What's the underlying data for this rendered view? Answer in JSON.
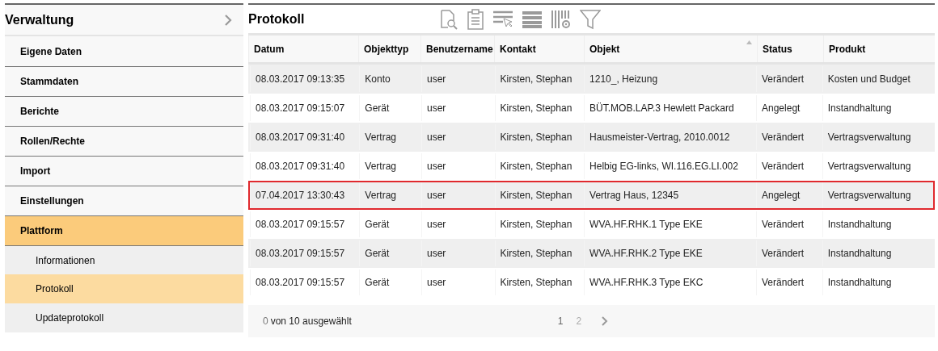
{
  "sidebar": {
    "title": "Verwaltung",
    "items": [
      {
        "label": "Eigene Daten",
        "selected": false
      },
      {
        "label": "Stammdaten",
        "selected": false
      },
      {
        "label": "Berichte",
        "selected": false
      },
      {
        "label": "Rollen/Rechte",
        "selected": false
      },
      {
        "label": "Import",
        "selected": false
      },
      {
        "label": "Einstellungen",
        "selected": false
      },
      {
        "label": "Plattform",
        "selected": true,
        "children": [
          {
            "label": "Informationen",
            "selected": false
          },
          {
            "label": "Protokoll",
            "selected": true
          },
          {
            "label": "Updateprotokoll",
            "selected": false
          }
        ]
      }
    ]
  },
  "main": {
    "title": "Protokoll",
    "table": {
      "columns": [
        {
          "label": "Datum",
          "sorted": false
        },
        {
          "label": "Objekttyp",
          "sorted": false
        },
        {
          "label": "Benutzername",
          "sorted": false
        },
        {
          "label": "Kontakt",
          "sorted": false
        },
        {
          "label": "Objekt",
          "sorted": true
        },
        {
          "label": "Status",
          "sorted": false
        },
        {
          "label": "Produkt",
          "sorted": false
        }
      ],
      "rows": [
        {
          "highlighted": false,
          "cells": [
            "08.03.2017 09:13:35",
            "Konto",
            "user",
            "Kirsten, Stephan",
            "1210_, Heizung",
            "Verändert",
            "Kosten und Budget"
          ]
        },
        {
          "highlighted": false,
          "cells": [
            "08.03.2017 09:15:07",
            "Gerät",
            "user",
            "Kirsten, Stephan",
            "BÜT.MOB.LAP.3 Hewlett Packard",
            "Angelegt",
            "Instandhaltung"
          ]
        },
        {
          "highlighted": false,
          "cells": [
            "08.03.2017 09:31:40",
            "Vertrag",
            "user",
            "Kirsten, Stephan",
            "Hausmeister-Vertrag, 2010.0012",
            "Verändert",
            "Vertragsverwaltung"
          ]
        },
        {
          "highlighted": false,
          "cells": [
            "08.03.2017 09:31:40",
            "Vertrag",
            "user",
            "Kirsten, Stephan",
            "Helbig EG-links, WI.116.EG.LI.002",
            "Verändert",
            "Vertragsverwaltung"
          ]
        },
        {
          "highlighted": true,
          "cells": [
            "07.04.2017 13:30:43",
            "Vertrag",
            "user",
            "Kirsten, Stephan",
            "Vertrag Haus, 12345",
            "Angelegt",
            "Vertragsverwaltung"
          ]
        },
        {
          "highlighted": false,
          "cells": [
            "08.03.2017 09:15:57",
            "Gerät",
            "user",
            "Kirsten, Stephan",
            "WVA.HF.RHK.1 Type EKE",
            "Verändert",
            "Instandhaltung"
          ]
        },
        {
          "highlighted": false,
          "cells": [
            "08.03.2017 09:15:57",
            "Gerät",
            "user",
            "Kirsten, Stephan",
            "WVA.HF.RHK.2 Type EKE",
            "Verändert",
            "Instandhaltung"
          ]
        },
        {
          "highlighted": false,
          "cells": [
            "08.03.2017 09:15:57",
            "Gerät",
            "user",
            "Kirsten, Stephan",
            "WVA.HF.RHK.3 Type EKC",
            "Verändert",
            "Instandhaltung"
          ]
        }
      ]
    },
    "footer": {
      "selected_count": "0",
      "selection_text": "von 10 ausgewählt",
      "pages": [
        {
          "label": "1",
          "selected": true
        },
        {
          "label": "2",
          "selected": false
        }
      ]
    }
  }
}
